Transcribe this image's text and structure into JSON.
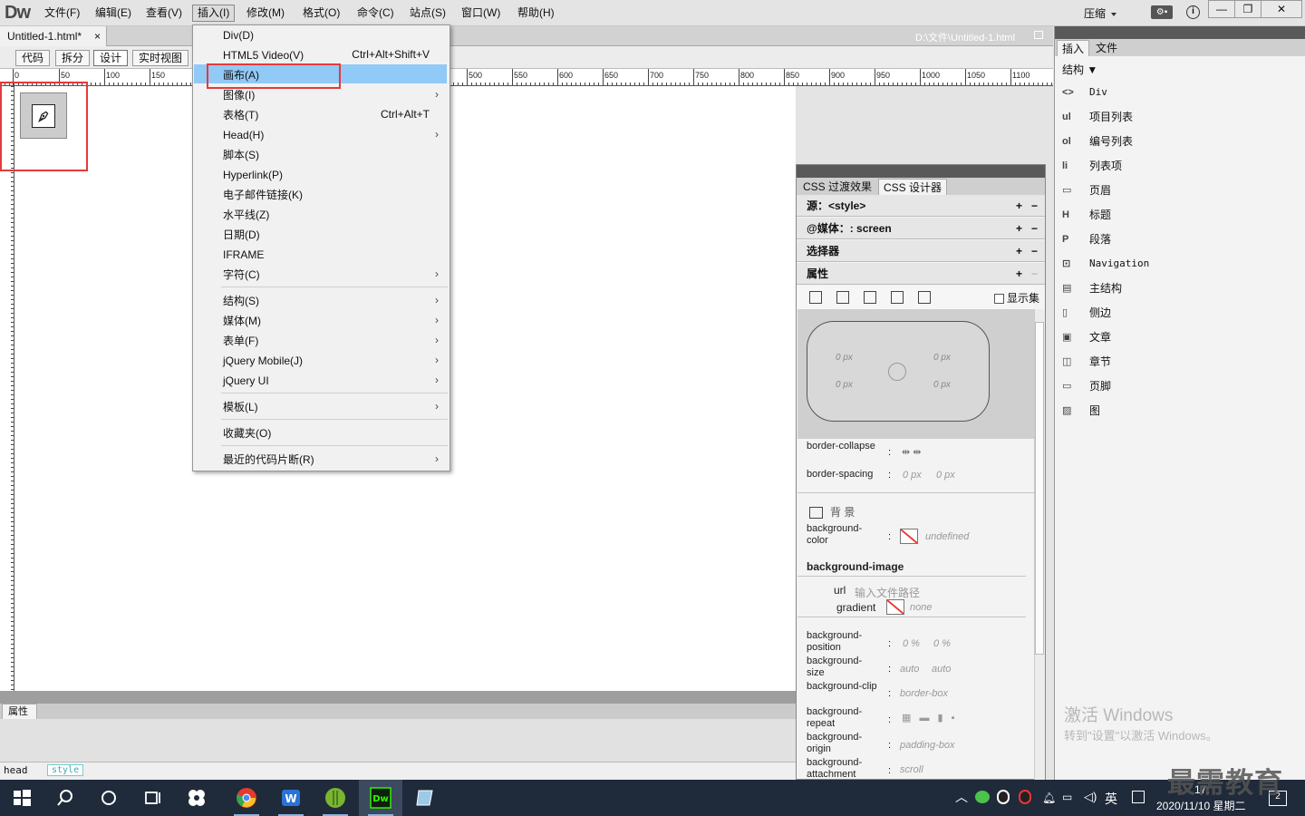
{
  "app": {
    "logo": "Dw",
    "menus": [
      "文件(F)",
      "编辑(E)",
      "查看(V)",
      "插入(I)",
      "修改(M)",
      "格式(O)",
      "命令(C)",
      "站点(S)",
      "窗口(W)",
      "帮助(H)"
    ],
    "active_menu": "插入(I)",
    "compress_label": "压缩",
    "window_min": "—",
    "window_restore": "❐",
    "window_close": "✕"
  },
  "document": {
    "tab_title": "Untitled-1.html*",
    "tab_close": "×",
    "file_path": "D:\\文件\\Untitled-1.html",
    "view_buttons": [
      "代码",
      "拆分",
      "设计",
      "实时视图"
    ],
    "active_view": "设计"
  },
  "ruler": {
    "marks": [
      "0",
      "50",
      "100",
      "150",
      "500",
      "550",
      "600",
      "650",
      "700",
      "750",
      "800",
      "850",
      "900",
      "950",
      "1000",
      "1050",
      "1100"
    ]
  },
  "insert_menu": {
    "items": [
      {
        "label": "Div(D)",
        "shortcut": "",
        "submenu": false
      },
      {
        "label": "HTML5 Video(V)",
        "shortcut": "Ctrl+Alt+Shift+V",
        "submenu": false
      },
      {
        "label": "画布(A)",
        "shortcut": "",
        "submenu": false,
        "selected": true
      },
      {
        "label": "图像(I)",
        "shortcut": "",
        "submenu": true
      },
      {
        "label": "表格(T)",
        "shortcut": "Ctrl+Alt+T",
        "submenu": false
      },
      {
        "label": "Head(H)",
        "shortcut": "",
        "submenu": true
      },
      {
        "label": "脚本(S)",
        "shortcut": "",
        "submenu": false
      },
      {
        "label": "Hyperlink(P)",
        "shortcut": "",
        "submenu": false
      },
      {
        "label": "电子邮件链接(K)",
        "shortcut": "",
        "submenu": false
      },
      {
        "label": "水平线(Z)",
        "shortcut": "",
        "submenu": false
      },
      {
        "label": "日期(D)",
        "shortcut": "",
        "submenu": false
      },
      {
        "label": "IFRAME",
        "shortcut": "",
        "submenu": false
      },
      {
        "label": "字符(C)",
        "shortcut": "",
        "submenu": true
      },
      {
        "label": "结构(S)",
        "shortcut": "",
        "submenu": true
      },
      {
        "label": "媒体(M)",
        "shortcut": "",
        "submenu": true
      },
      {
        "label": "表单(F)",
        "shortcut": "",
        "submenu": true
      },
      {
        "label": "jQuery Mobile(J)",
        "shortcut": "",
        "submenu": true
      },
      {
        "label": "jQuery UI",
        "shortcut": "",
        "submenu": true
      },
      {
        "label": "模板(L)",
        "shortcut": "",
        "submenu": true
      },
      {
        "label": "收藏夹(O)",
        "shortcut": "",
        "submenu": false
      },
      {
        "label": "最近的代码片断(R)",
        "shortcut": "",
        "submenu": true
      }
    ],
    "submenu_arrow": "›"
  },
  "properties_panel": {
    "tab": "属性",
    "tag_head": "head",
    "tag_style": "style"
  },
  "css_designer": {
    "tabs": [
      "CSS 过渡效果",
      "CSS 设计器"
    ],
    "active_tab": "CSS 设计器",
    "sections": {
      "source": "源：<style>",
      "media": "@媒体：: screen",
      "selector": "选择器",
      "properties": "属性"
    },
    "plus": "+",
    "minus": "−",
    "show_set": "显示集",
    "radius_values": [
      "0 px",
      "0 px",
      "0 px",
      "0 px"
    ],
    "border_collapse": "border-collapse",
    "border_spacing": "border-spacing",
    "border_spacing_values": [
      "0 px",
      "0 px"
    ],
    "background_heading": "背 景",
    "background_color_label": "background-color",
    "background_color_value": "undefined",
    "background_image": "background-image",
    "url_label": "url",
    "url_placeholder": "输入文件路径",
    "gradient_label": "gradient",
    "gradient_value": "none",
    "position_label": "background-position",
    "position_values": [
      "0 %",
      "0 %"
    ],
    "size_label": "background-size",
    "size_values": [
      "auto",
      "auto"
    ],
    "clip_label": "background-clip",
    "clip_value": "border-box",
    "repeat_label": "background-repeat",
    "origin_label": "background-origin",
    "origin_value": "padding-box",
    "attachment_label": "background-attachment",
    "attachment_value": "scroll",
    "colon": ":"
  },
  "insert_panel": {
    "tabs": [
      "插入",
      "文件"
    ],
    "category": "结构",
    "items": [
      {
        "icon": "<>",
        "label": "Div"
      },
      {
        "icon": "ul",
        "label": "项目列表"
      },
      {
        "icon": "ol",
        "label": "编号列表"
      },
      {
        "icon": "li",
        "label": "列表项"
      },
      {
        "icon": "▭",
        "label": "页眉"
      },
      {
        "icon": "H",
        "label": "标题"
      },
      {
        "icon": "P",
        "label": "段落"
      },
      {
        "icon": "⊡",
        "label": "Navigation"
      },
      {
        "icon": "▤",
        "label": "主结构"
      },
      {
        "icon": "▯",
        "label": "侧边"
      },
      {
        "icon": "▣",
        "label": "文章"
      },
      {
        "icon": "◫",
        "label": "章节"
      },
      {
        "icon": "▭",
        "label": "页脚"
      },
      {
        "icon": "▨",
        "label": "图"
      }
    ]
  },
  "watermarks": {
    "activate_title": "激活 Windows",
    "activate_sub": "转到\"设置\"以激活 Windows。",
    "brand": "最需教育"
  },
  "taskbar": {
    "ime": "英",
    "date": "2020/11/10 星期二",
    "time": "17:",
    "notifications": "2"
  }
}
